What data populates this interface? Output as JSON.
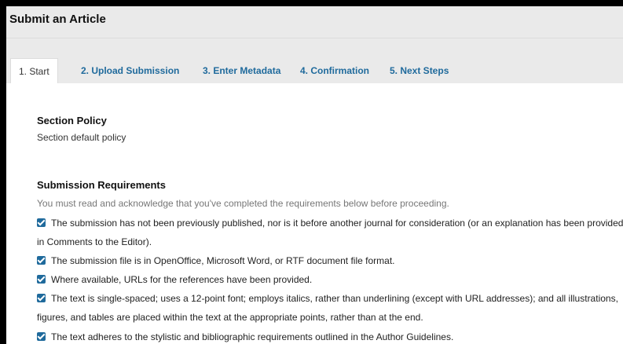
{
  "header": {
    "title": "Submit an Article"
  },
  "tabs": [
    {
      "label": "1. Start"
    },
    {
      "label": "2. Upload Submission"
    },
    {
      "label": "3. Enter Metadata"
    },
    {
      "label": "4. Confirmation"
    },
    {
      "label": "5. Next Steps"
    }
  ],
  "section_policy": {
    "heading": "Section Policy",
    "text": "Section default policy"
  },
  "submission_requirements": {
    "heading": "Submission Requirements",
    "instruction": "You must read and acknowledge that you've completed the requirements below before proceeding.",
    "items": [
      {
        "line1": "The submission has not been previously published, nor is it before another journal for consideration (or an explanation has been provided",
        "line2": "in Comments to the Editor).",
        "checked": true
      },
      {
        "line1": "The submission file is in OpenOffice, Microsoft Word, or RTF document file format.",
        "checked": true
      },
      {
        "line1": "Where available, URLs for the references have been provided.",
        "checked": true
      },
      {
        "line1": "The text is single-spaced; uses a 12-point font; employs italics, rather than underlining (except with URL addresses); and all illustrations,",
        "line2": "figures, and tables are placed within the text at the appropriate points, rather than at the end.",
        "checked": true
      },
      {
        "line1": "The text adheres to the stylistic and bibliographic requirements outlined in the Author Guidelines.",
        "checked": true
      }
    ]
  },
  "colors": {
    "link": "#1f6a9c",
    "checkbox": "#1f6a9c",
    "header_bg": "#eaeaea"
  }
}
